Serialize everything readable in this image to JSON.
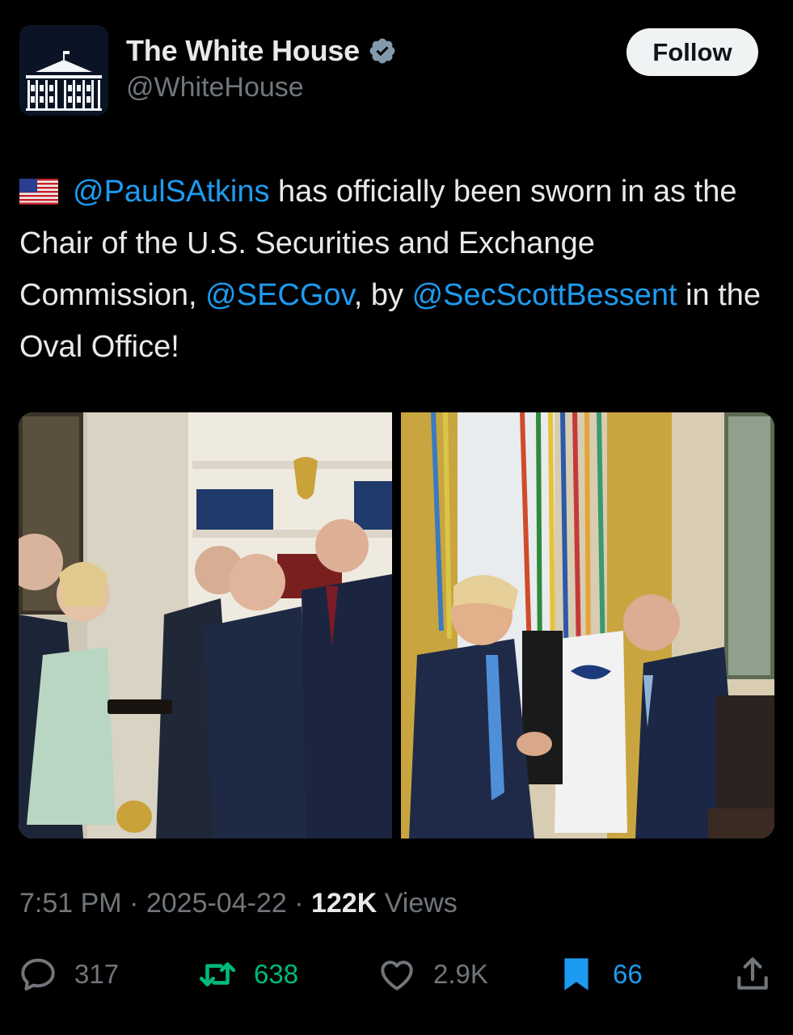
{
  "header": {
    "display_name": "The White House",
    "handle": "@WhiteHouse",
    "follow_label": "Follow"
  },
  "tweet": {
    "flag_icon": "us-flag-icon",
    "mention_1": "@PaulSAtkins",
    "text_1": " has officially been sworn in as the Chair of the U.S. Securities and Exchange Commission, ",
    "mention_2": "@SECGov",
    "text_2": ", by ",
    "mention_3": "@SecScottBessent",
    "text_3": " in the Oval Office!"
  },
  "meta": {
    "time": "7:51 PM",
    "sep_1": " · ",
    "date": "2025-04-22",
    "sep_2": " · ",
    "views_count": "122K",
    "views_label": " Views"
  },
  "actions": {
    "replies": "317",
    "retweets": "638",
    "likes": "2.9K",
    "bookmarks": "66"
  },
  "colors": {
    "accent": "#1d9bf0",
    "retweet": "#00ba7c",
    "muted": "#71767b",
    "text": "#e7e9ea"
  }
}
